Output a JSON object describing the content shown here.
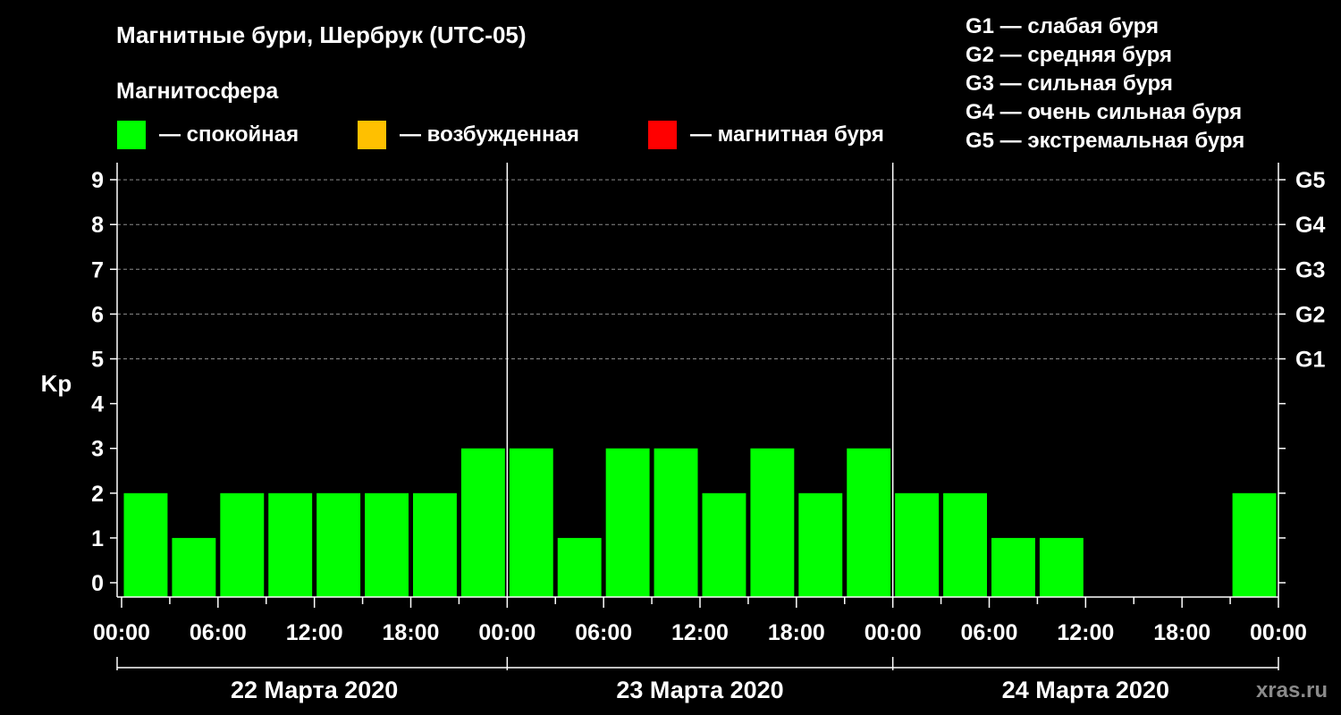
{
  "header": {
    "title": "Магнитные бури, Шербрук (UTC-05)",
    "legend_heading": "Магнитосфера"
  },
  "legend": [
    {
      "label": "— спокойная",
      "color": "#00ff00"
    },
    {
      "label": "— возбужденная",
      "color": "#ffc000"
    },
    {
      "label": "— магнитная буря",
      "color": "#ff0000"
    }
  ],
  "storm_scale": [
    "G1 — слабая буря",
    "G2 — средняя буря",
    "G3 — сильная буря",
    "G4 — очень сильная буря",
    "G5 — экстремальная буря"
  ],
  "watermark": "xras.ru",
  "chart_data": {
    "type": "bar",
    "ylabel": "Kp",
    "ylim": [
      0,
      9
    ],
    "y_ticks": [
      "0",
      "1",
      "2",
      "3",
      "4",
      "5",
      "6",
      "7",
      "8",
      "9"
    ],
    "right_ticks": [
      {
        "kp": 5,
        "label": "G1"
      },
      {
        "kp": 6,
        "label": "G2"
      },
      {
        "kp": 7,
        "label": "G3"
      },
      {
        "kp": 8,
        "label": "G4"
      },
      {
        "kp": 9,
        "label": "G5"
      }
    ],
    "x_tick_labels": [
      "00:00",
      "06:00",
      "12:00",
      "18:00",
      "00:00",
      "06:00",
      "12:00",
      "18:00",
      "00:00",
      "06:00",
      "12:00",
      "18:00",
      "00:00"
    ],
    "days": [
      "22 Марта 2020",
      "23 Марта 2020",
      "24 Марта 2020"
    ],
    "interval_hours": 3,
    "grid": "horizontal dashed",
    "bar_color": "#00ff00",
    "values": [
      2,
      1,
      2,
      2,
      2,
      2,
      2,
      3,
      3,
      1,
      3,
      3,
      2,
      3,
      2,
      3,
      2,
      2,
      1,
      1,
      null,
      null,
      null,
      2
    ]
  }
}
